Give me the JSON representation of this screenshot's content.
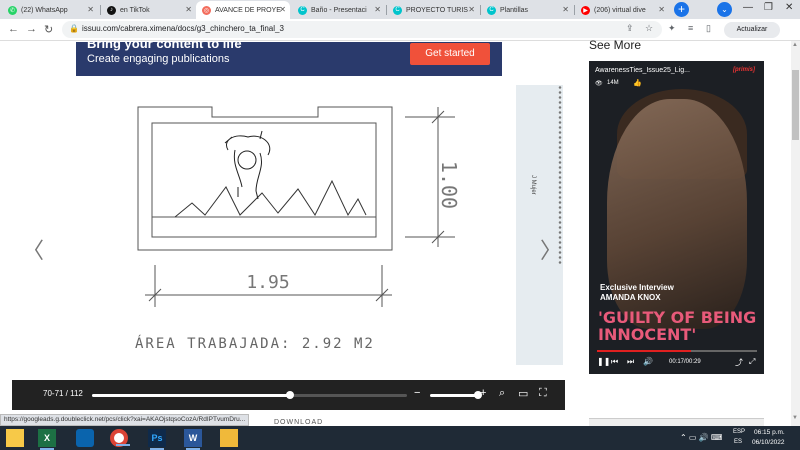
{
  "browser": {
    "tabs": [
      {
        "label": "(22) WhatsApp",
        "icon": "whatsapp-icon",
        "color": "#25d366"
      },
      {
        "label": "en TikTok",
        "icon": "tiktok-icon",
        "color": "#111111"
      },
      {
        "label": "AVANCE DE PROYE",
        "icon": "issuu-icon",
        "color": "#f36d5d"
      },
      {
        "label": "Baño - Presentaci",
        "icon": "canva-icon",
        "color": "#00c4cc"
      },
      {
        "label": "PROYECTO TURIS",
        "icon": "canva-icon",
        "color": "#00c4cc"
      },
      {
        "label": "Plantillas",
        "icon": "canva-icon",
        "color": "#00c4cc"
      },
      {
        "label": "(206) virtual dive",
        "icon": "youtube-icon",
        "color": "#ff0000"
      }
    ],
    "active_tab": 2,
    "url": "issuu.com/cabrera.ximena/docs/g3_chinchero_ta_final_3",
    "update_label": "Actualizar"
  },
  "banner": {
    "line1": "Bring your content to life",
    "line2": "Create engaging publications",
    "cta": "Get started"
  },
  "document": {
    "dimension_vertical": "1.00",
    "dimension_horizontal": "1.95",
    "area_label": "ÁREA TRABAJADA: 2.92 M2",
    "side_text": "J  Mujer",
    "download_label": "DOWNLOAD"
  },
  "viewer": {
    "page_label": "70-71 / 112",
    "page_progress": 0.63
  },
  "sidebar": {
    "heading": "See More",
    "video": {
      "title": "AwarenessTies_Issue25_Lig...",
      "brand": "[primis]",
      "views": "14M",
      "subtitle1": "Exclusive Interview",
      "subtitle2": "AMANDA KNOX",
      "quote": "'GUILTY OF BEING INNOCENT'",
      "time": "00:17/00:29",
      "progress": 0.59
    }
  },
  "status_link": "https://googleads.g.doubleclick.net/pcs/click?xai=AKAOjstqsoCozA/RdIPTvumDru...",
  "taskbar": {
    "apps": [
      {
        "name": "file-explorer",
        "label": ""
      },
      {
        "name": "excel",
        "label": "X"
      },
      {
        "name": "outlook",
        "label": ""
      },
      {
        "name": "chrome",
        "label": ""
      },
      {
        "name": "photoshop",
        "label": "Ps"
      },
      {
        "name": "word",
        "label": "W"
      },
      {
        "name": "folder",
        "label": ""
      }
    ],
    "lang1": "ESP",
    "lang2": "ES",
    "time": "06:15 p.m.",
    "date": "06/10/2022"
  }
}
